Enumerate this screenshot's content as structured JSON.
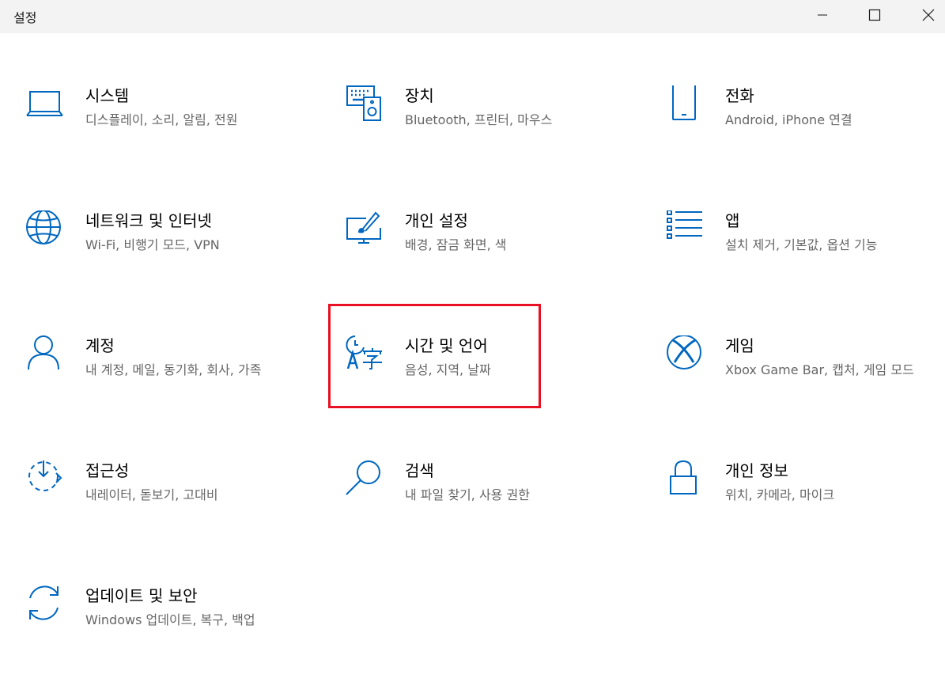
{
  "window": {
    "title": "설정",
    "minimize_icon": "minimize-icon",
    "maximize_icon": "maximize-icon",
    "close_icon": "close-icon"
  },
  "accent_color": "#0067c0",
  "highlight_color": "#e81123",
  "tiles": [
    {
      "title": "시스템",
      "desc": "디스플레이, 소리, 알림, 전원",
      "icon": "laptop-icon"
    },
    {
      "title": "장치",
      "desc": "Bluetooth, 프린터, 마우스",
      "icon": "devices-icon"
    },
    {
      "title": "전화",
      "desc": "Android, iPhone 연결",
      "icon": "phone-icon"
    },
    {
      "title": "네트워크 및 인터넷",
      "desc": "Wi-Fi, 비행기 모드, VPN",
      "icon": "globe-icon"
    },
    {
      "title": "개인 설정",
      "desc": "배경, 잠금 화면, 색",
      "icon": "personalization-icon"
    },
    {
      "title": "앱",
      "desc": "설치 제거, 기본값, 옵션 기능",
      "icon": "apps-list-icon"
    },
    {
      "title": "계정",
      "desc": "내 계정, 메일, 동기화, 회사, 가족",
      "icon": "person-icon"
    },
    {
      "title": "시간 및 언어",
      "desc": "음성, 지역, 날짜",
      "icon": "time-language-icon"
    },
    {
      "title": "게임",
      "desc": "Xbox Game Bar, 캡처, 게임 모드",
      "icon": "xbox-icon"
    },
    {
      "title": "접근성",
      "desc": "내레이터, 돋보기, 고대비",
      "icon": "ease-of-access-icon"
    },
    {
      "title": "검색",
      "desc": "내 파일 찾기, 사용 권한",
      "icon": "search-icon"
    },
    {
      "title": "개인 정보",
      "desc": "위치, 카메라, 마이크",
      "icon": "lock-icon"
    },
    {
      "title": "업데이트 및 보안",
      "desc": "Windows 업데이트, 복구, 백업",
      "icon": "sync-icon"
    }
  ]
}
